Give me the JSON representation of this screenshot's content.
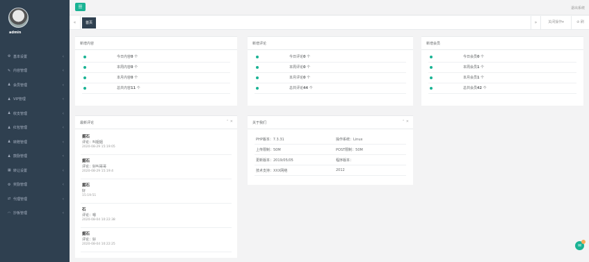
{
  "sidebar": {
    "username": "admin",
    "items": [
      {
        "label": "基本设置",
        "icon": "gear-icon"
      },
      {
        "label": "内容管理",
        "icon": "edit-icon"
      },
      {
        "label": "会员管理",
        "icon": "user-icon"
      },
      {
        "label": "VIP管理",
        "icon": "user-icon"
      },
      {
        "label": "收支管理",
        "icon": "user-icon"
      },
      {
        "label": "红包管理",
        "icon": "user-icon"
      },
      {
        "label": "转赠管理",
        "icon": "user-icon"
      },
      {
        "label": "鼓励管理",
        "icon": "user-icon"
      },
      {
        "label": "转让设置",
        "icon": "table-icon"
      },
      {
        "label": "奖励管理",
        "icon": "gear-icon"
      },
      {
        "label": "代理管理",
        "icon": "exchange-icon"
      },
      {
        "label": "抄板管理",
        "icon": "wifi-icon"
      }
    ]
  },
  "topnav": {
    "menu_icon": "☰",
    "right_text": "退出系统"
  },
  "tabs": {
    "prev": "«",
    "home": "首页",
    "next": "»",
    "close": "关闭操作▾",
    "refresh": "⊘ 刷"
  },
  "panels": {
    "new_content": {
      "title": "新增内容",
      "rows": [
        {
          "label": "今日内容",
          "count": "0",
          "unit": "个"
        },
        {
          "label": "本周内容",
          "count": "0",
          "unit": "个"
        },
        {
          "label": "本月内容",
          "count": "0",
          "unit": "个"
        },
        {
          "label": "总共内容",
          "count": "11",
          "unit": "个"
        }
      ]
    },
    "new_comments": {
      "title": "新增评论",
      "rows": [
        {
          "label": "今日评论",
          "count": "0",
          "unit": "个"
        },
        {
          "label": "本周评论",
          "count": "0",
          "unit": "个"
        },
        {
          "label": "本月评论",
          "count": "0",
          "unit": "个"
        },
        {
          "label": "总共评论",
          "count": "44",
          "unit": "个"
        }
      ]
    },
    "new_members": {
      "title": "新增会员",
      "rows": [
        {
          "label": "今日会员",
          "count": "0",
          "unit": "个"
        },
        {
          "label": "本周会员",
          "count": "1",
          "unit": "个"
        },
        {
          "label": "本月会员",
          "count": "1",
          "unit": "个"
        },
        {
          "label": "总共会员",
          "count": "42",
          "unit": "个"
        }
      ]
    },
    "latest_comments": {
      "title": "最新评论",
      "tools": "⌃ ✕",
      "items": [
        {
          "user": "掘石",
          "comment": "评论：叫姐姐",
          "time": "2020-08-29 15:19:05"
        },
        {
          "user": "掘石",
          "comment": "评论：好叫哥哥",
          "time": "2020-08-29 15:19:4"
        },
        {
          "user": "掘石",
          "comment": "好",
          "time": "15:19:51"
        },
        {
          "user": "石",
          "comment": "评论：嗯",
          "time": "2020-08-04 10:22:38"
        },
        {
          "user": "掘石",
          "comment": "评论：好",
          "time": "2020-08-04 10:22:25"
        }
      ]
    },
    "about": {
      "title": "关于我们",
      "tools": "⌃ ✕",
      "rows": [
        {
          "l": "PHP版本：7.3.31",
          "r": "操作系统：Linux"
        },
        {
          "l": "上传限制：50M",
          "r": "POST限制：50M"
        },
        {
          "l": "更新版本：2019/05/05",
          "r": "程序版本："
        },
        {
          "l": "技术支持：XXX网络",
          "r": "2012"
        }
      ]
    }
  },
  "fab": {
    "icon": "chat-icon"
  }
}
